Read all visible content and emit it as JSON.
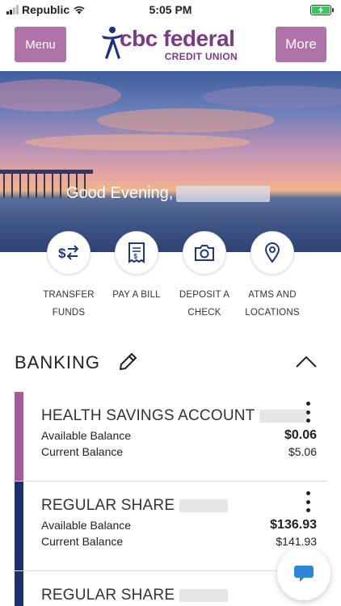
{
  "status_bar": {
    "carrier": "Republic",
    "time": "5:05 PM"
  },
  "header": {
    "menu_label": "Menu",
    "more_label": "More",
    "logo_text": "cbc federal",
    "logo_subtext": "CREDIT UNION",
    "brand_color": "#7a3d84",
    "button_color": "#b073a7"
  },
  "hero": {
    "greeting": "Good Evening,"
  },
  "quick_actions": [
    {
      "icon": "transfer-icon",
      "line1": "TRANSFER",
      "line2": "FUNDS"
    },
    {
      "icon": "bill-icon",
      "line1": "PAY A BILL",
      "line2": ""
    },
    {
      "icon": "camera-icon",
      "line1": "DEPOSIT A",
      "line2": "CHECK"
    },
    {
      "icon": "location-pin-icon",
      "line1": "ATMS AND",
      "line2": "LOCATIONS"
    }
  ],
  "banking": {
    "title": "BANKING",
    "accounts": [
      {
        "name": "HEALTH SAVINGS ACCOUNT",
        "available_label": "Available Balance",
        "available": "$0.06",
        "current_label": "Current Balance",
        "current": "$5.06",
        "color": "#a35c98"
      },
      {
        "name": "REGULAR SHARE",
        "available_label": "Available Balance",
        "available": "$136.93",
        "current_label": "Current Balance",
        "current": "$141.93",
        "color": "#1f2f6b"
      },
      {
        "name": "REGULAR SHARE",
        "color": "#1f2f6b"
      }
    ]
  }
}
